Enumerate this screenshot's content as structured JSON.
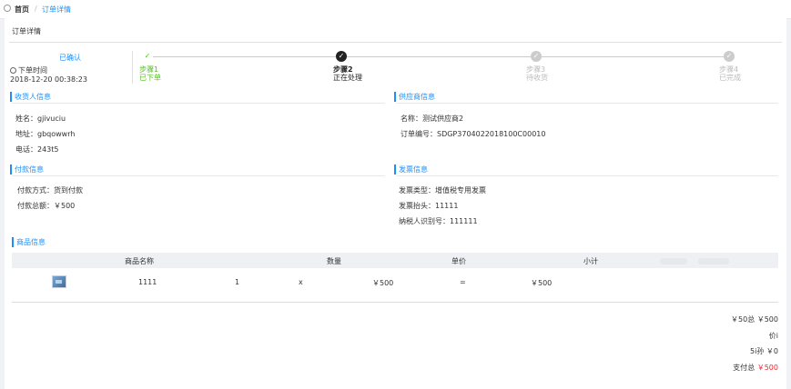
{
  "breadcrumb": {
    "home": "首页",
    "current": "订单详情"
  },
  "page_title": "订单详情",
  "status": {
    "label": "已确认",
    "order_time_label": "下单时间",
    "order_time": "2018-12-20 00:38:23"
  },
  "steps": [
    {
      "title": "步骤1",
      "desc": "已下单",
      "state": "done"
    },
    {
      "title": "步骤2",
      "desc": "正在处理",
      "state": "active"
    },
    {
      "title": "步骤3",
      "desc": "待收货",
      "state": "todo"
    },
    {
      "title": "步骤4",
      "desc": "已完成",
      "state": "todo"
    }
  ],
  "receiver": {
    "title": "收货人信息",
    "name": "姓名：gjivuciu",
    "address": "地址：gbqowwrh",
    "phone": "电话：243t5"
  },
  "supplier": {
    "title": "供应商信息",
    "name": "名称：测试供应商2",
    "order_no": "订单编号：SDGP3704022018100C00010"
  },
  "payment": {
    "title": "付款信息",
    "method": "付款方式：货到付款",
    "total": "付款总额：￥500"
  },
  "invoice": {
    "title": "发票信息",
    "type": "发票类型：增值税专用发票",
    "header": "发票抬头：11111",
    "tax_id": "纳税人识别号：111111"
  },
  "goods": {
    "title": "商品信息",
    "columns": [
      "商品名称",
      "数量",
      "单价",
      "小计"
    ],
    "rows": [
      {
        "name": "1111",
        "qty": "1",
        "times": "x",
        "price": "￥500",
        "equals": "=",
        "subtotal": "￥500"
      }
    ]
  },
  "summary": {
    "goods_total": "￥50总 ￥500",
    "discount_label": "价i",
    "shipping": "5i孙 ￥0",
    "pay_total_label": "支付总",
    "pay_total_value": "￥500"
  },
  "colors": {
    "accent": "#1890ff",
    "done": "#52c41a",
    "price": "#f5222d"
  }
}
